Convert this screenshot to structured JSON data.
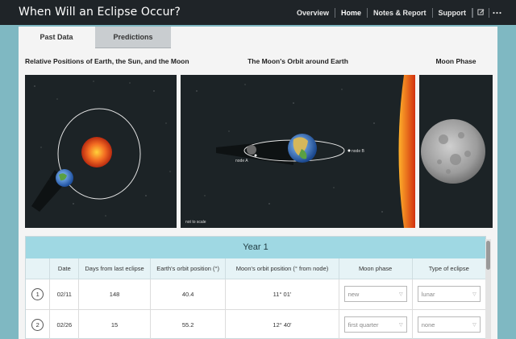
{
  "app": {
    "title": "When Will an Eclipse Occur?"
  },
  "nav": {
    "items": [
      "Overview",
      "Home",
      "Notes & Report",
      "Support"
    ],
    "active": "Home",
    "icons": [
      "edit-icon",
      "more-icon"
    ]
  },
  "tabs": {
    "past_data": "Past Data",
    "predictions": "Predictions",
    "active": "Past Data"
  },
  "columns": {
    "relative_positions": "Relative Positions of Earth, the Sun, and the Moon",
    "moon_orbit": "The Moon's Orbit around Earth",
    "moon_phase": "Moon Phase"
  },
  "orbit_view": {
    "node_a": "node A",
    "node_b": "node B",
    "scale_note": "not to scale"
  },
  "table": {
    "year_title": "Year 1",
    "headers": [
      "",
      "Date",
      "Days from last eclipse",
      "Earth's orbit position (°)",
      "Moon's orbit position (° from node)",
      "Moon phase",
      "Type of eclipse"
    ],
    "rows": [
      {
        "num": "1",
        "date": "02/11",
        "days": "148",
        "earth": "40.4",
        "moon": "11° 01'",
        "phase": "new",
        "eclipse": "lunar"
      },
      {
        "num": "2",
        "date": "02/26",
        "days": "15",
        "earth": "55.2",
        "moon": "12° 40'",
        "phase": "first quarter",
        "eclipse": "none"
      }
    ]
  },
  "colors": {
    "topbar": "#1f2428",
    "accent": "#9fd8e3",
    "background": "#7fb8c2",
    "sun": "#f0522a"
  }
}
